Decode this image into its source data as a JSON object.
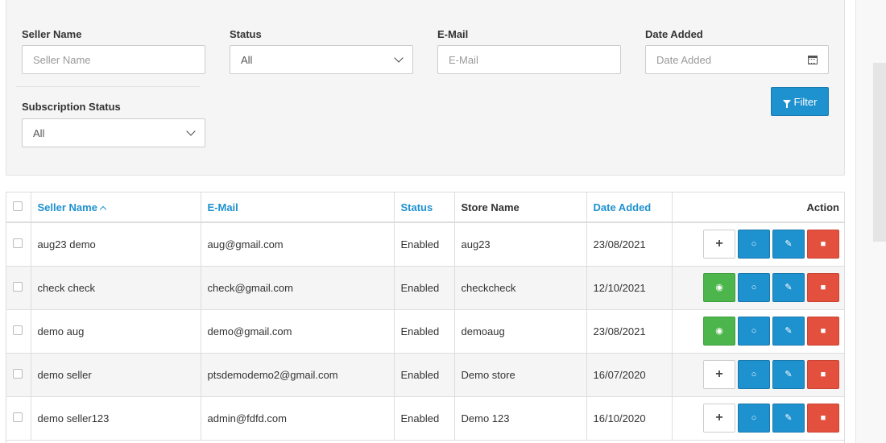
{
  "filters": {
    "seller_name": {
      "label": "Seller Name",
      "placeholder": "Seller Name"
    },
    "status": {
      "label": "Status",
      "value": "All"
    },
    "email": {
      "label": "E-Mail",
      "placeholder": "E-Mail"
    },
    "date_added": {
      "label": "Date Added",
      "placeholder": "Date Added"
    },
    "subscription_status": {
      "label": "Subscription Status",
      "value": "All"
    },
    "filter_button": "Filter"
  },
  "table": {
    "columns": {
      "seller_name": "Seller Name",
      "email": "E-Mail",
      "status": "Status",
      "store_name": "Store Name",
      "date_added": "Date Added",
      "action": "Action"
    },
    "rows": [
      {
        "seller_name": "aug23 demo",
        "email": "aug@gmail.com",
        "status": "Enabled",
        "store_name": "aug23",
        "date_added": "23/08/2021",
        "first_action": "plus"
      },
      {
        "seller_name": "check check",
        "email": "check@gmail.com",
        "status": "Enabled",
        "store_name": "checkcheck",
        "date_added": "12/10/2021",
        "first_action": "eye"
      },
      {
        "seller_name": "demo aug",
        "email": "demo@gmail.com",
        "status": "Enabled",
        "store_name": "demoaug",
        "date_added": "23/08/2021",
        "first_action": "eye"
      },
      {
        "seller_name": "demo seller",
        "email": "ptsdemodemo2@gmail.com",
        "status": "Enabled",
        "store_name": "Demo store",
        "date_added": "16/07/2020",
        "first_action": "plus"
      },
      {
        "seller_name": "demo seller123",
        "email": "admin@fdfd.com",
        "status": "Enabled",
        "store_name": "Demo 123",
        "date_added": "16/10/2020",
        "first_action": "plus"
      }
    ]
  },
  "colors": {
    "primary": "#1e91cf",
    "success": "#4cb64c",
    "danger": "#e3503e",
    "panel": "#f5f5f5"
  },
  "icons": {
    "calendar": "calendar-icon",
    "funnel": "filter-icon",
    "plus": "plus-icon",
    "eye": "eye-icon",
    "comments": "comments-icon",
    "edit": "edit-icon",
    "trash": "trash-icon"
  }
}
